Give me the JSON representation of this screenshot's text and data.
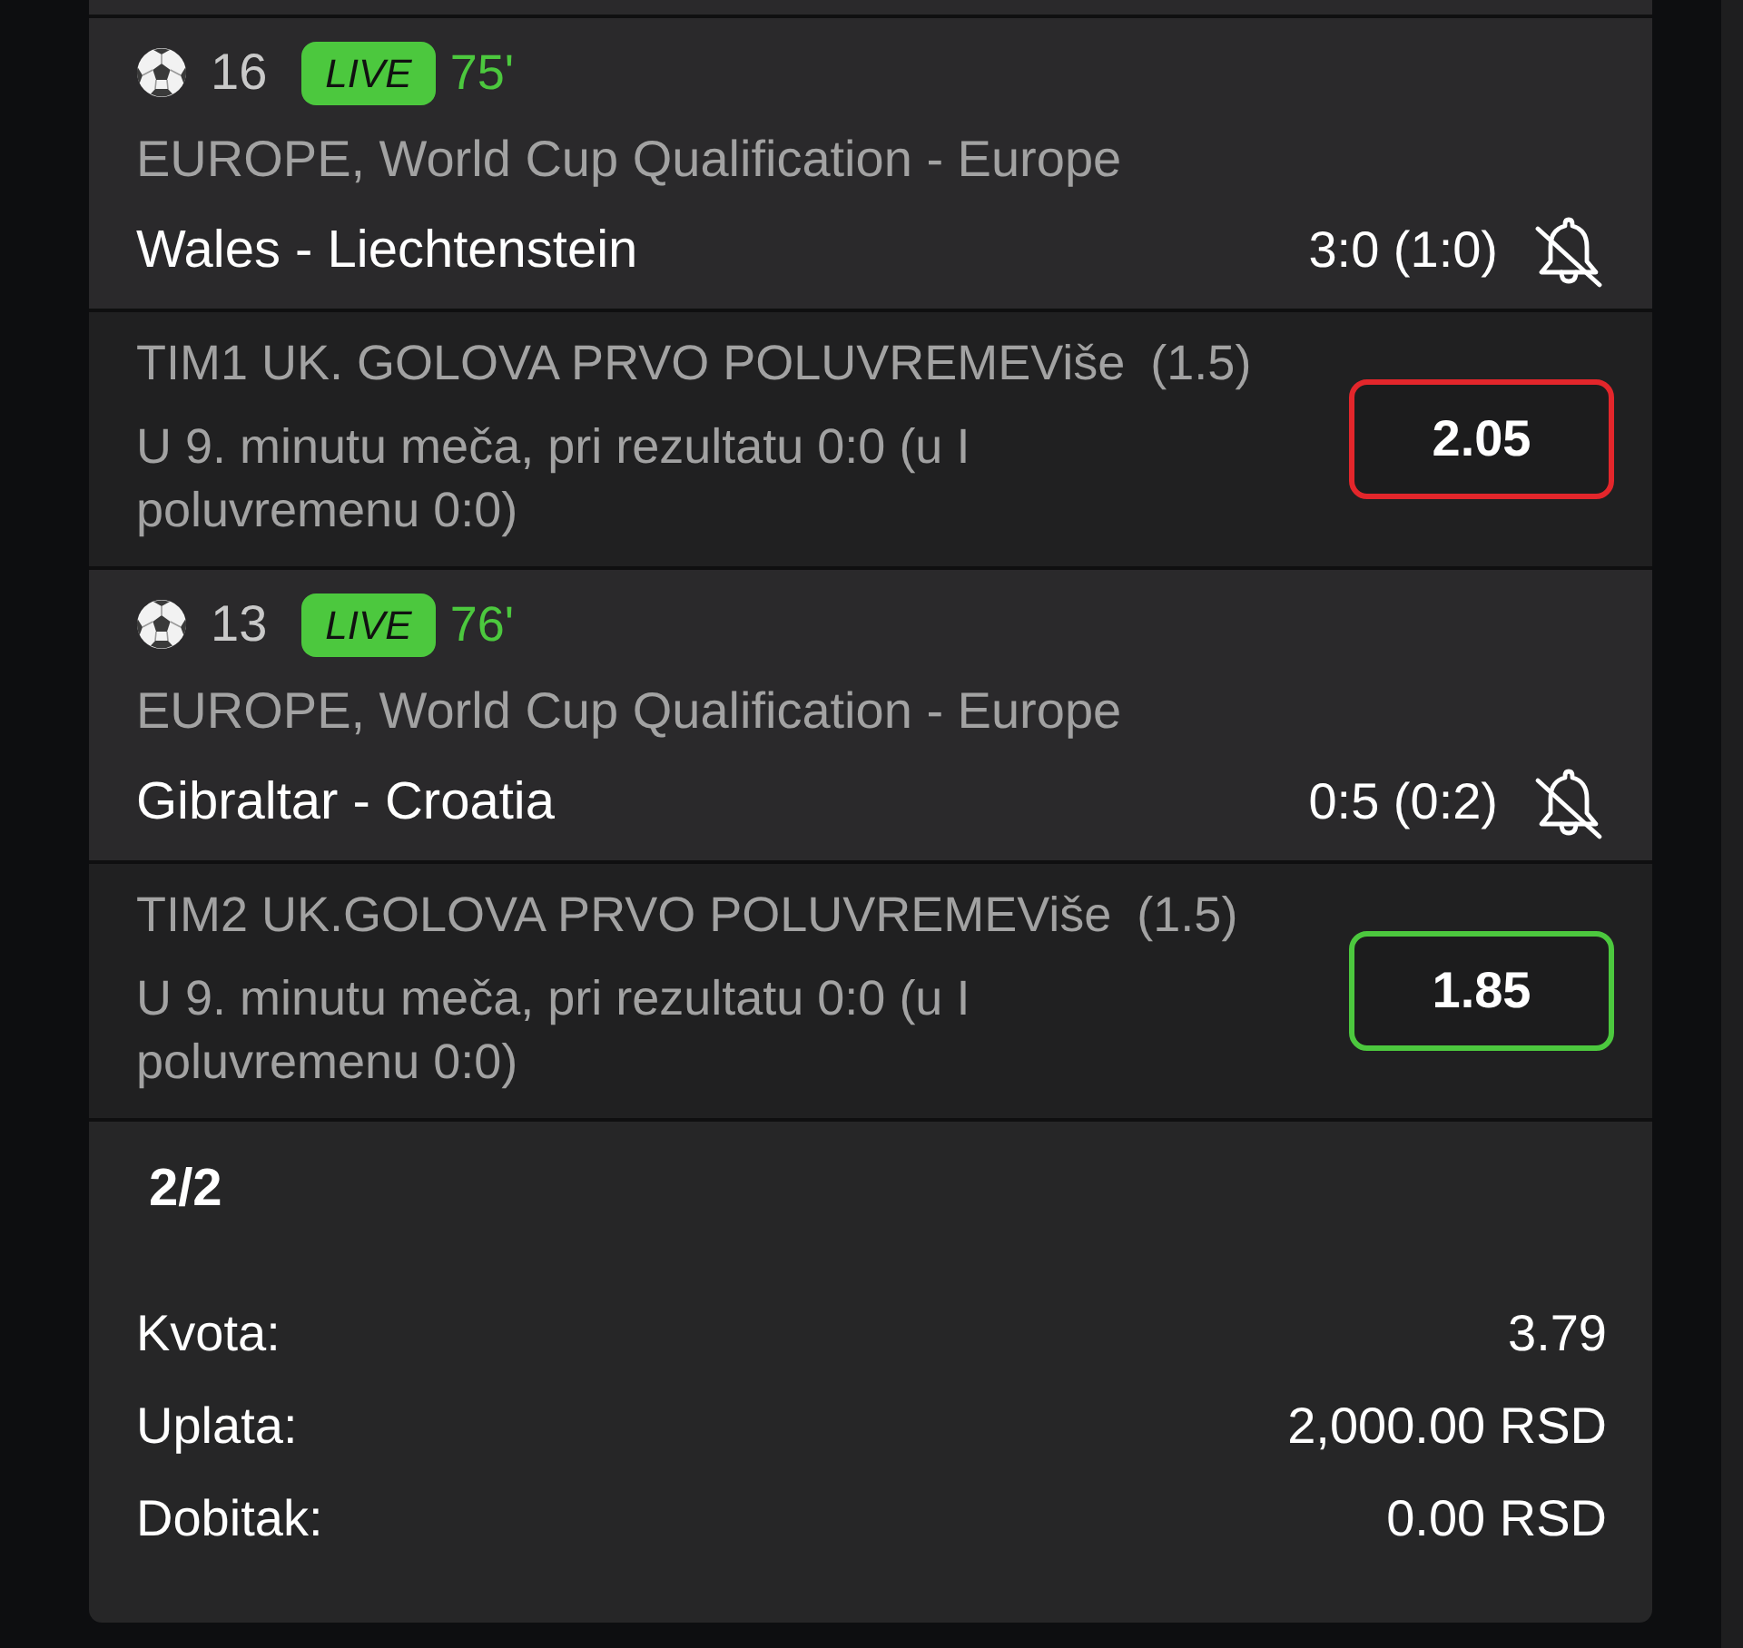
{
  "matches": [
    {
      "number": "16",
      "live_badge": "LIVE",
      "minute": "75'",
      "league": "EUROPE, World Cup Qualification - Europe",
      "teams": "Wales - Liechtenstein",
      "score": "3:0 (1:0)",
      "notify": false,
      "market": "TIM1 UK. GOLOVA PRVO POLUVREMEViše",
      "line": "(1.5)",
      "description": "U 9. minutu meča, pri rezultatu 0:0 (u I poluvremenu 0:0)",
      "pick": {
        "odds": "2.05",
        "color": "#e3262b"
      }
    },
    {
      "number": "13",
      "live_badge": "LIVE",
      "minute": "76'",
      "league": "EUROPE, World Cup Qualification - Europe",
      "teams": "Gibraltar - Croatia",
      "score": "0:5 (0:2)",
      "notify": false,
      "market": "TIM2 UK.GOLOVA PRVO POLUVREMEViše",
      "line": "(1.5)",
      "description": "U 9. minutu meča, pri rezultatu 0:0 (u I poluvremenu 0:0)",
      "pick": {
        "odds": "1.85",
        "color": "#4cc83e"
      }
    }
  ],
  "summary": {
    "count": "2/2",
    "rows": [
      {
        "label": "Kvota:",
        "value": "3.79"
      },
      {
        "label": "Uplata:",
        "value": "2,000.00 RSD"
      },
      {
        "label": "Dobitak:",
        "value": "0.00 RSD"
      }
    ]
  }
}
